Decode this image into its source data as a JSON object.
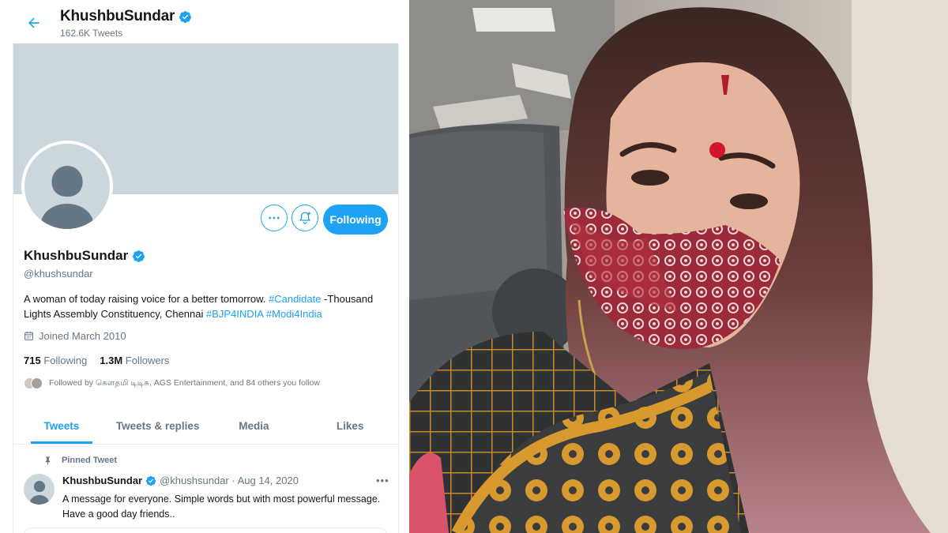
{
  "profile_header": {
    "name": "KhushbuSundar",
    "tweet_count": "162.6K Tweets"
  },
  "actions": {
    "following_label": "Following"
  },
  "profile": {
    "name": "KhushbuSundar",
    "handle": "@khushsundar",
    "bio_text_1": "A woman of today raising voice for a better tomorrow. ",
    "bio_tag_1": "#Candidate",
    "bio_text_2": " -Thousand Lights Assembly Constituency, Chennai ",
    "bio_tag_2": "#BJP4INDIA",
    "bio_tag_3": "#Modi4India",
    "joined": "Joined March 2010",
    "following_count": "715",
    "following_label": "Following",
    "followers_count": "1.3M",
    "followers_label": "Followers",
    "followed_by": "Followed by கௌதமி டிடிசு, AGS Entertainment, and 84 others you follow"
  },
  "tabs": [
    {
      "label": "Tweets",
      "active": true
    },
    {
      "label": "Tweets & replies",
      "active": false
    },
    {
      "label": "Media",
      "active": false
    },
    {
      "label": "Likes",
      "active": false
    }
  ],
  "pinned_tweet": {
    "pinned_label": "Pinned Tweet",
    "name": "KhushbuSundar",
    "meta": "@khushsundar · Aug 14, 2020",
    "text": "A message for everyone. Simple words but with most powerful message. Have a good day friends.."
  },
  "colors": {
    "accent": "#1da1f2",
    "banner": "#ccd6dd",
    "secondary_text": "#657786"
  },
  "icons": [
    "back-arrow-icon",
    "verified-badge-icon",
    "more-icon",
    "notification-bell-icon",
    "calendar-icon",
    "pin-icon"
  ]
}
